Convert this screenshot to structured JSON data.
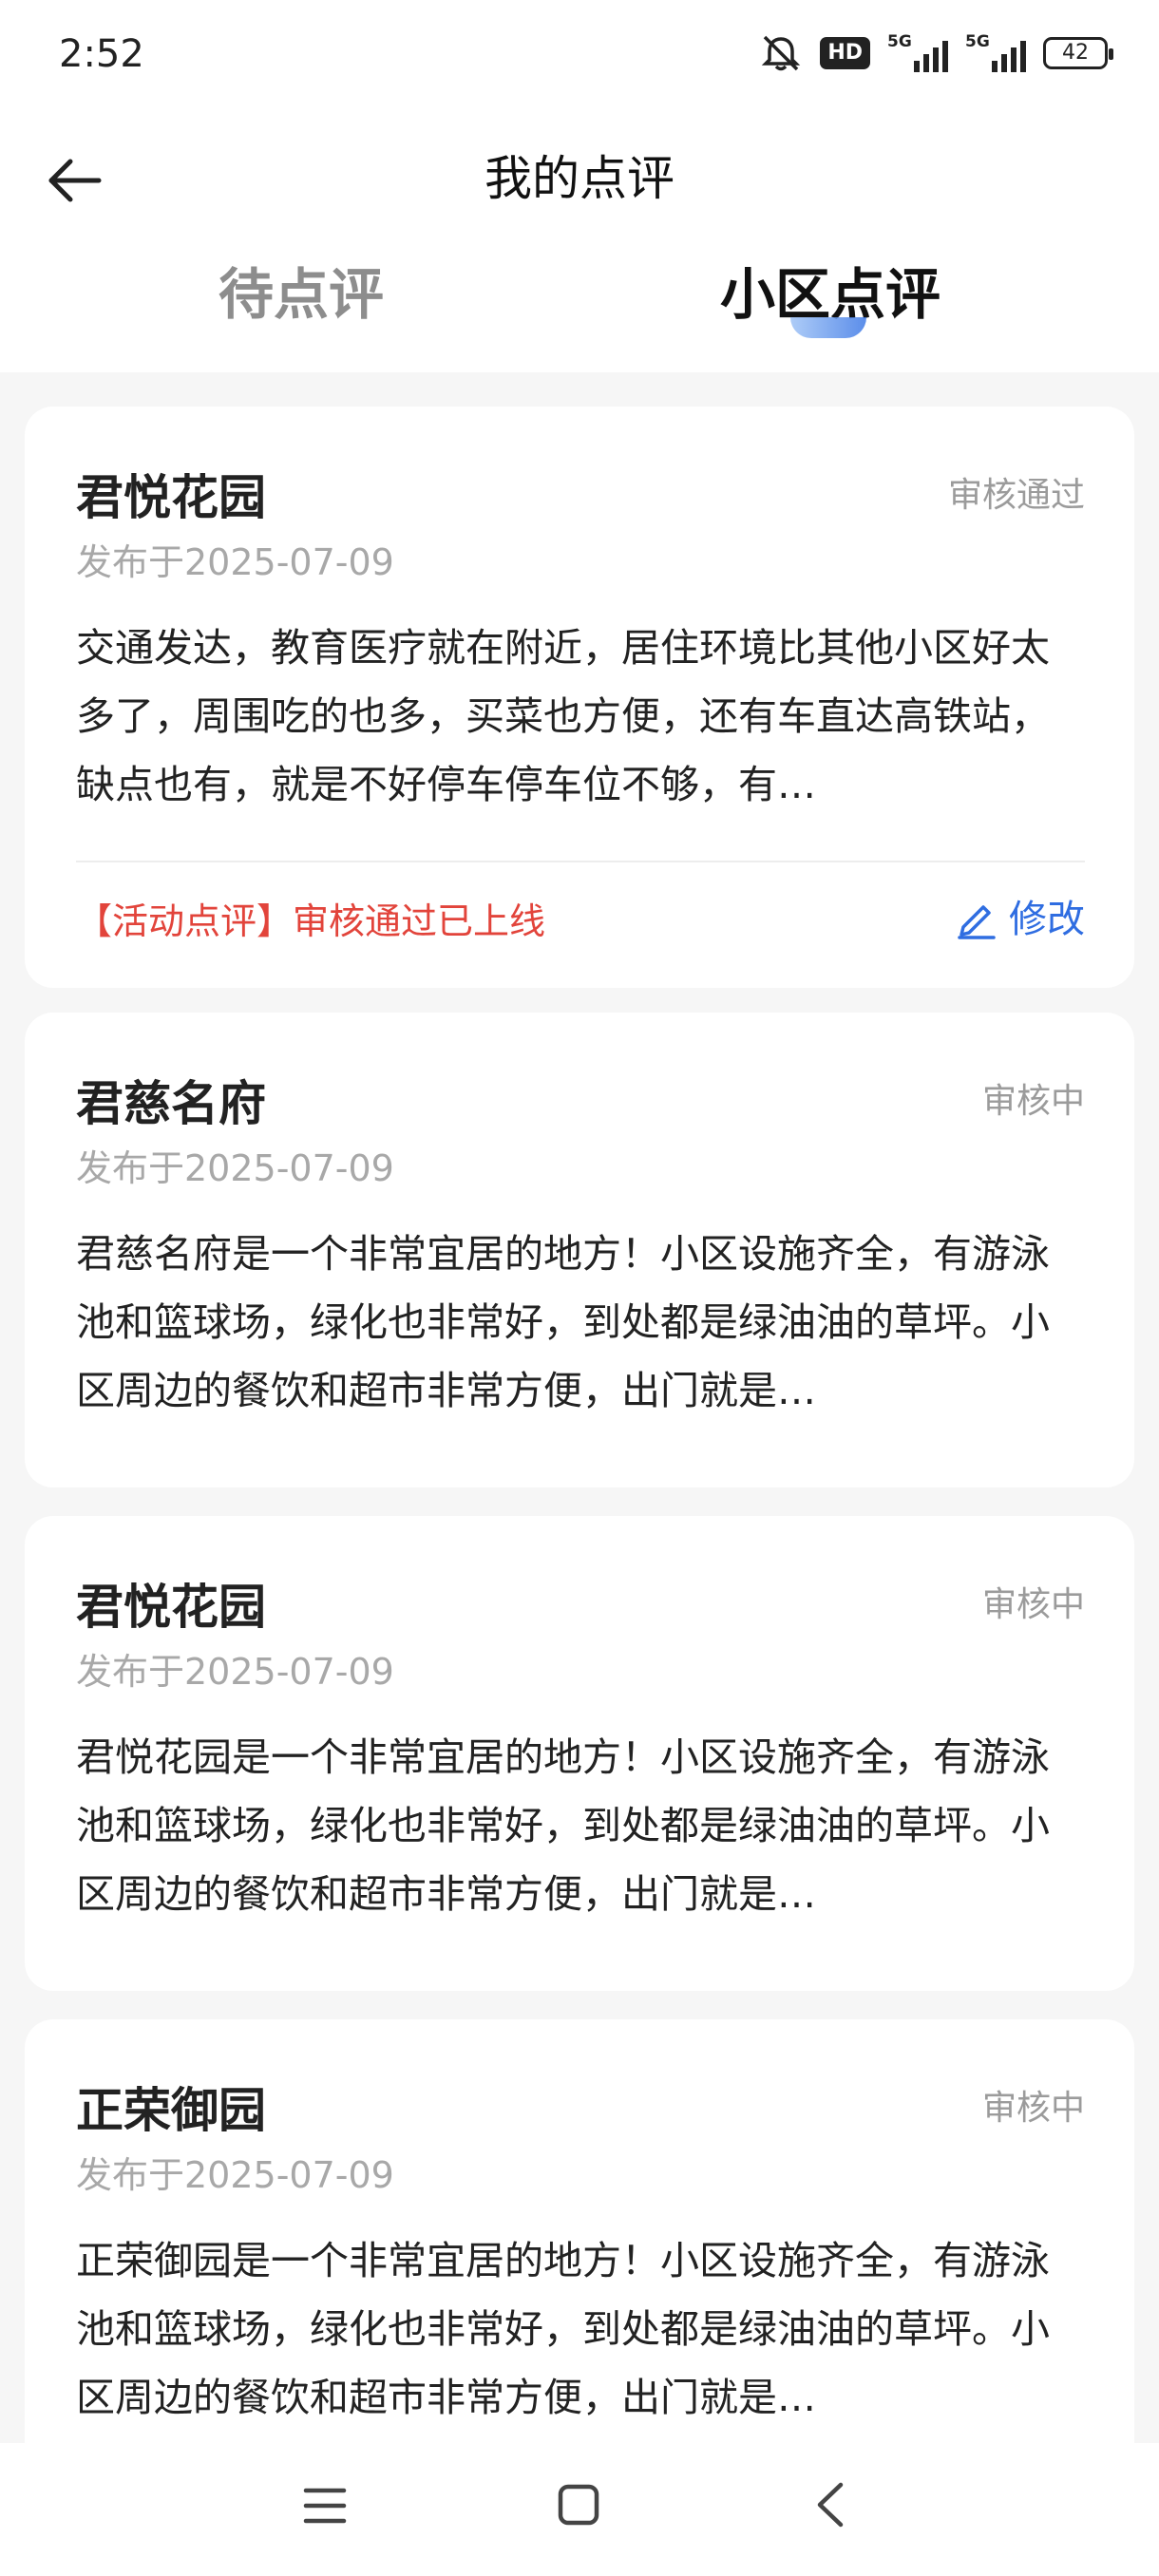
{
  "status_bar": {
    "time": "2:52",
    "hd_label": "HD",
    "sim1_label": "5G",
    "sim2_label": "5G",
    "battery_level": "42"
  },
  "header": {
    "title": "我的点评",
    "tabs": [
      {
        "label": "待点评",
        "active": false
      },
      {
        "label": "小区点评",
        "active": true
      }
    ]
  },
  "colors": {
    "accent": "#2f6de1",
    "activity_red": "#e2443b",
    "muted_text": "#9b9b9b",
    "page_bg": "#f6f6f6"
  },
  "reviews": [
    {
      "community": "君悦花园",
      "status": "审核通过",
      "date": "发布于2025-07-09",
      "text": "交通发达，教育医疗就在附近，居住环境比其他小区好太多了，周围吃的也多，买菜也方便，还有车直达高铁站，缺点也有，就是不好停车停车位不够，有…",
      "activity_note": "【活动点评】审核通过已上线",
      "edit_label": "修改"
    },
    {
      "community": "君慈名府",
      "status": "审核中",
      "date": "发布于2025-07-09",
      "text": "君慈名府是一个非常宜居的地方！小区设施齐全，有游泳池和篮球场，绿化也非常好，到处都是绿油油的草坪。小区周边的餐饮和超市非常方便，出门就是…"
    },
    {
      "community": "君悦花园",
      "status": "审核中",
      "date": "发布于2025-07-09",
      "text": "君悦花园是一个非常宜居的地方！小区设施齐全，有游泳池和篮球场，绿化也非常好，到处都是绿油油的草坪。小区周边的餐饮和超市非常方便，出门就是…"
    },
    {
      "community": "正荣御园",
      "status": "审核中",
      "date": "发布于2025-07-09",
      "text": "正荣御园是一个非常宜居的地方！小区设施齐全，有游泳池和篮球场，绿化也非常好，到处都是绿油油的草坪。小区周边的餐饮和超市非常方便，出门就是…"
    }
  ],
  "icons": {
    "back": "arrow-left-icon",
    "edit": "pencil-icon",
    "nav_menu": "menu-icon",
    "nav_home": "square-home-icon",
    "nav_back": "chevron-left-icon"
  }
}
